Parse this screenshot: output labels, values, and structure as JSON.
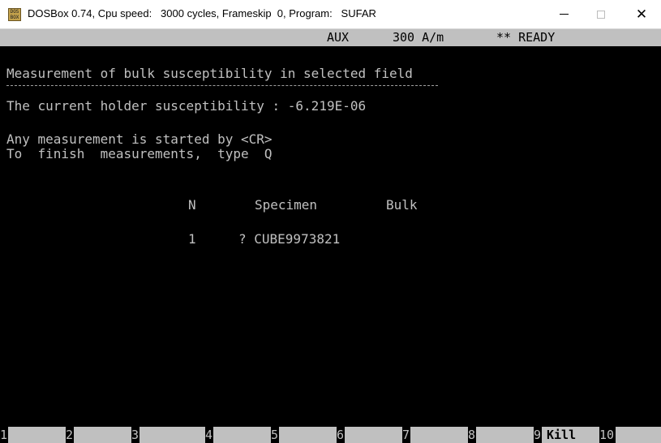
{
  "window": {
    "title": "DOSBox 0.74, Cpu speed:   3000 cycles, Frameskip  0, Program:   SUFAR",
    "icon": "dosbox-icon",
    "icon_text": "DOS\nBOX",
    "minimize_glyph": "—",
    "close_glyph": "✕"
  },
  "status": {
    "mode": "AUX",
    "field": "300 A/m",
    "state": "** READY"
  },
  "screen": {
    "heading": "Measurement of bulk susceptibility in selected field",
    "holder_line": "The current holder susceptibility : -6.219E-06",
    "instruction1": "Any measurement is started by <CR>",
    "instruction2": "To  finish  measurements,  type  Q"
  },
  "table": {
    "columns": [
      "N",
      "Specimen",
      "Bulk"
    ],
    "rows": [
      {
        "n": "1",
        "specimen": "? CUBE9973821",
        "bulk": ""
      }
    ]
  },
  "function_keys": [
    {
      "num": "1",
      "label": ""
    },
    {
      "num": "2",
      "label": ""
    },
    {
      "num": "3",
      "label": ""
    },
    {
      "num": "4",
      "label": ""
    },
    {
      "num": "5",
      "label": ""
    },
    {
      "num": "6",
      "label": ""
    },
    {
      "num": "7",
      "label": ""
    },
    {
      "num": "8",
      "label": ""
    },
    {
      "num": "9",
      "label": "Kill"
    },
    {
      "num": "10",
      "label": ""
    }
  ],
  "colors": {
    "screen_bg": "#000000",
    "screen_text": "#c0c0c0",
    "bar_bg": "#c0c0c0"
  }
}
